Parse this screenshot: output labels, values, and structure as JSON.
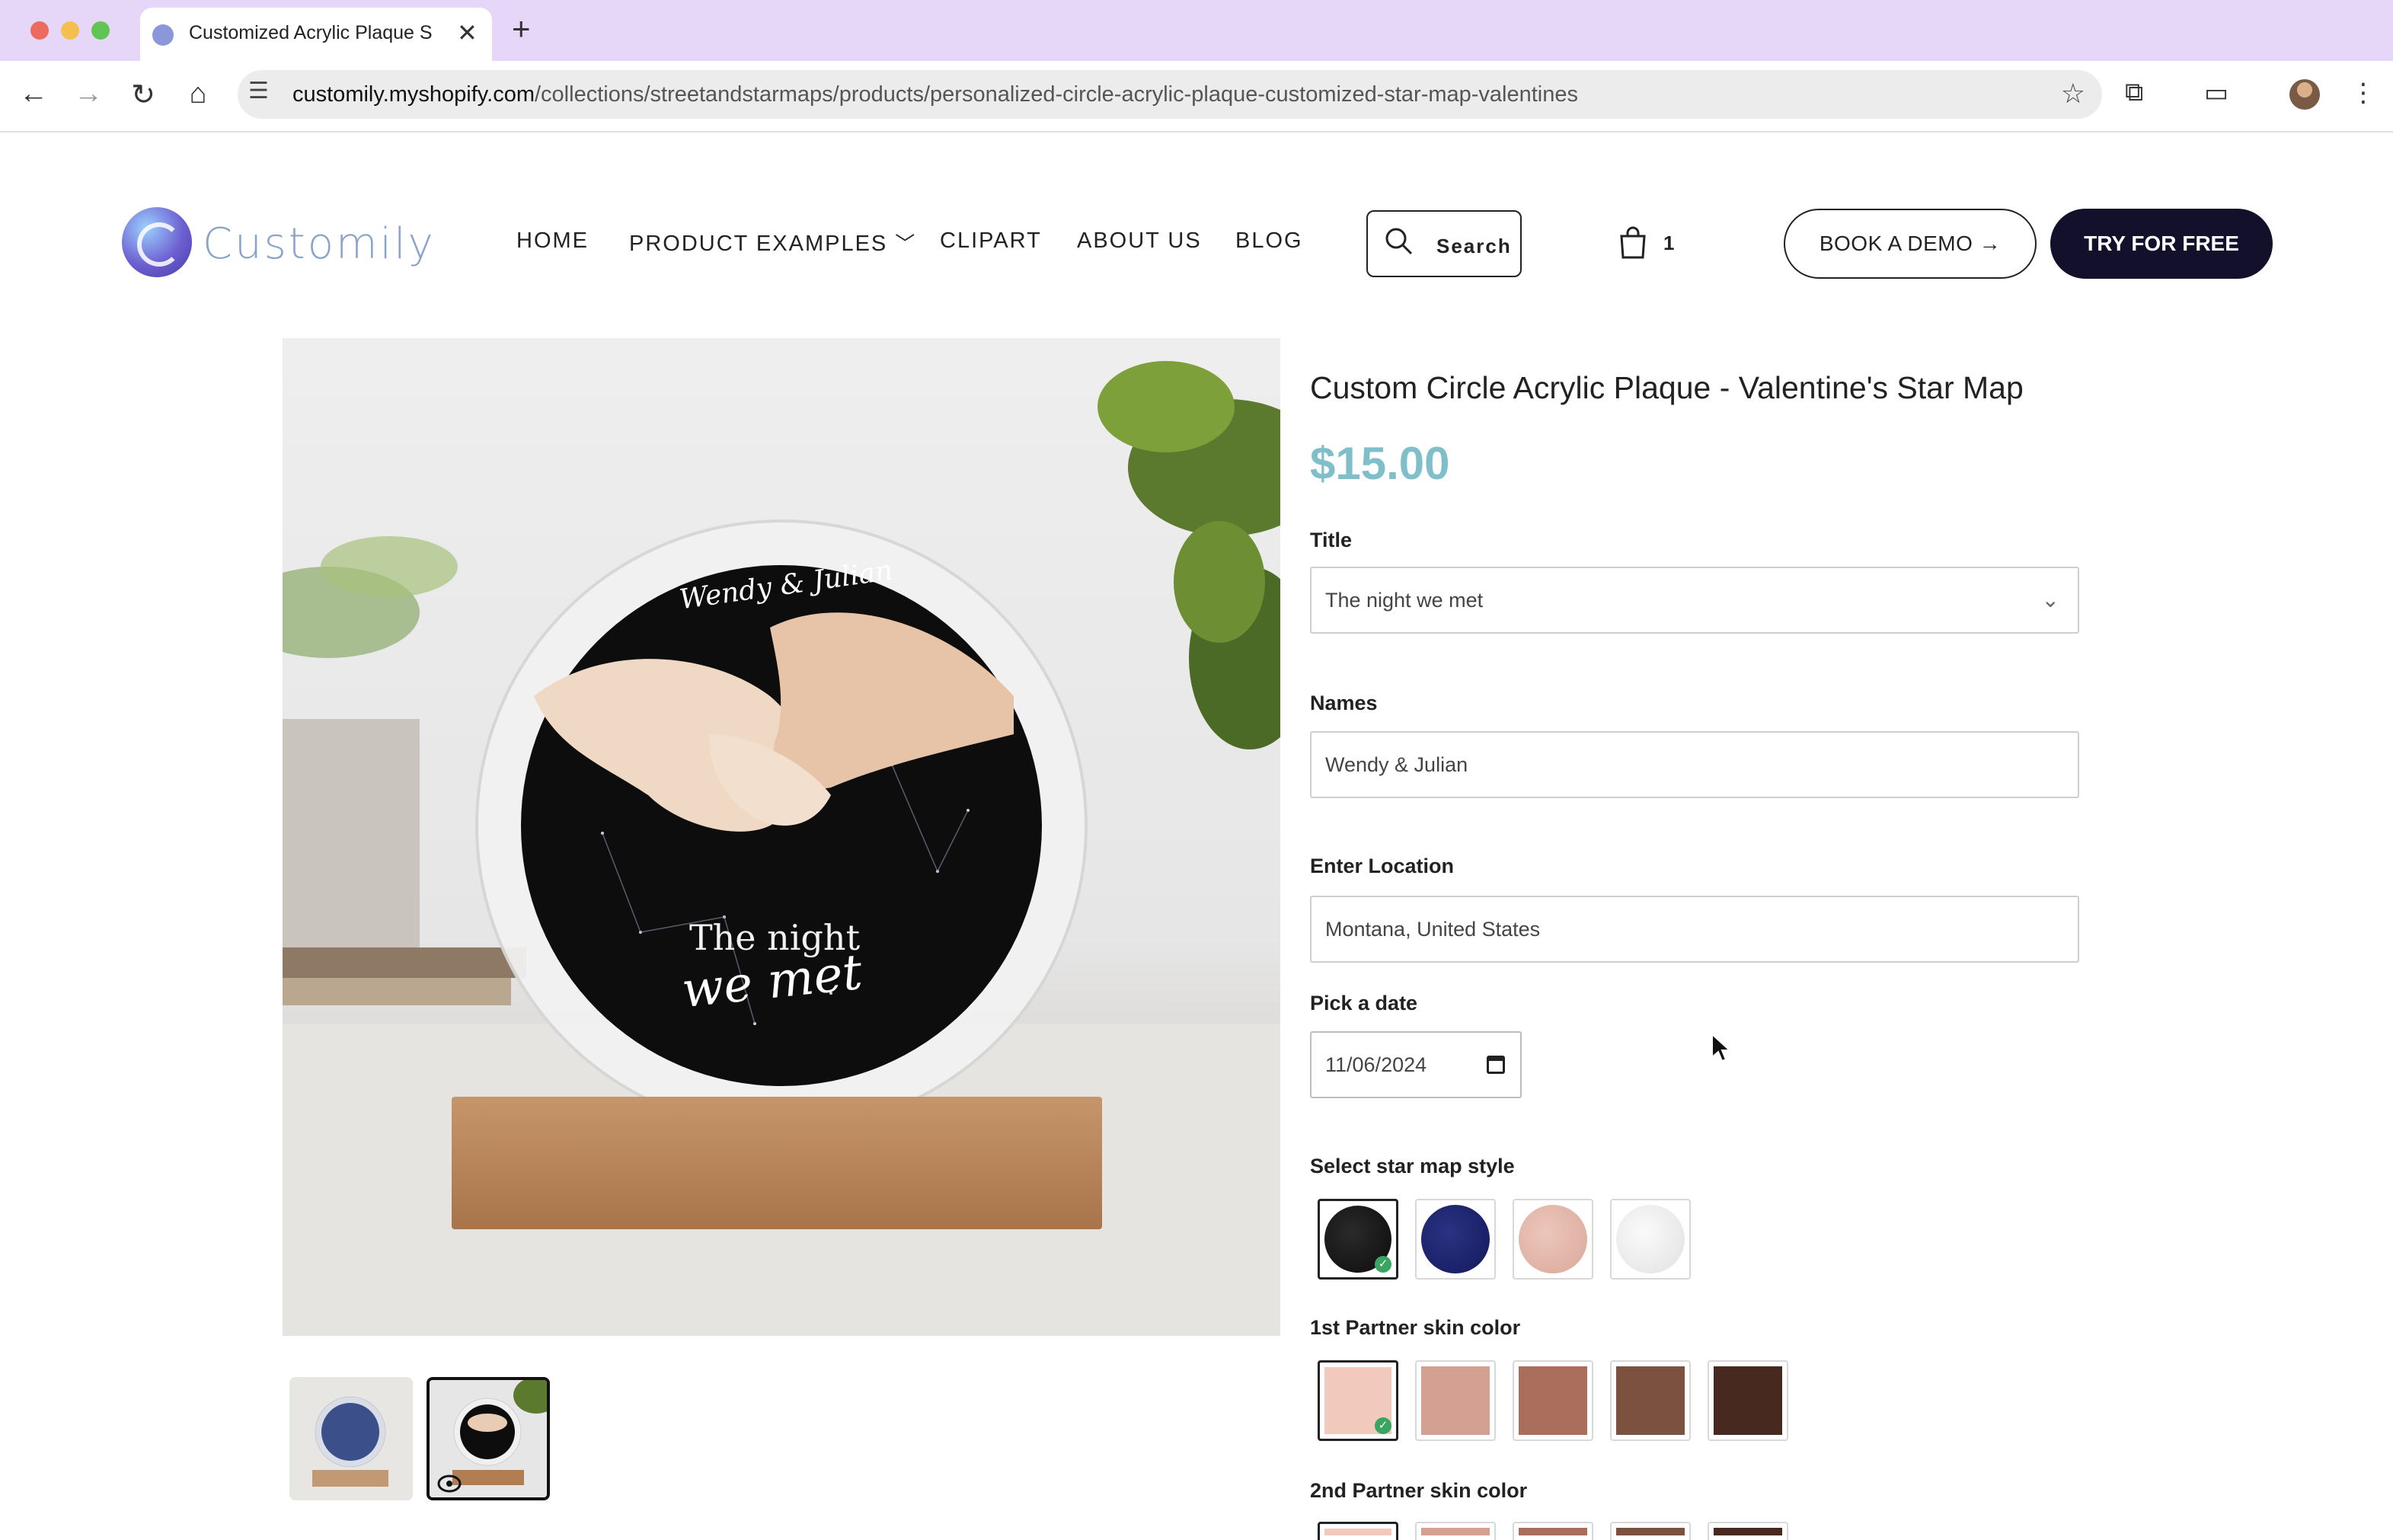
{
  "browser": {
    "tab_title": "Customized Acrylic Plaque St",
    "url_host": "customily.myshopify.com",
    "url_path": "/collections/streetandstarmaps/products/personalized-circle-acrylic-plaque-customized-star-map-valentines"
  },
  "header": {
    "logo_text": "Customily",
    "nav": [
      "HOME",
      "PRODUCT EXAMPLES",
      "CLIPART",
      "ABOUT US",
      "BLOG"
    ],
    "search_label": "Search",
    "cart_count": "1",
    "demo_label": "BOOK A DEMO →",
    "try_label": "TRY FOR FREE"
  },
  "product": {
    "title": "Custom Circle Acrylic Plaque - Valentine's Star Map",
    "price": "$15.00",
    "image_text": {
      "names": "Wendy & Julian",
      "line1": "The night",
      "line2": "we met"
    },
    "title_field": {
      "label": "Title",
      "value": "The night we met"
    },
    "names_field": {
      "label": "Names",
      "value": "Wendy & Julian"
    },
    "location_field": {
      "label": "Enter Location",
      "value": "Montana, United States"
    },
    "date_field": {
      "label": "Pick a date",
      "value": "11/06/2024"
    },
    "star_style": {
      "label": "Select star map style",
      "selected_index": 0
    },
    "skin1": {
      "label": "1st Partner skin color",
      "selected_index": 0
    },
    "skin2": {
      "label": "2nd Partner skin color"
    }
  },
  "colors": {
    "price": "#7fbfc9",
    "cta_bg": "#12102a",
    "star_styles": [
      "#0c0c0c",
      "#14195a",
      "#e3b7ab",
      "#efefef"
    ],
    "skins": [
      "#f1c9bd",
      "#d4a092",
      "#aa6e5c",
      "#7d5140",
      "#48291f"
    ]
  }
}
